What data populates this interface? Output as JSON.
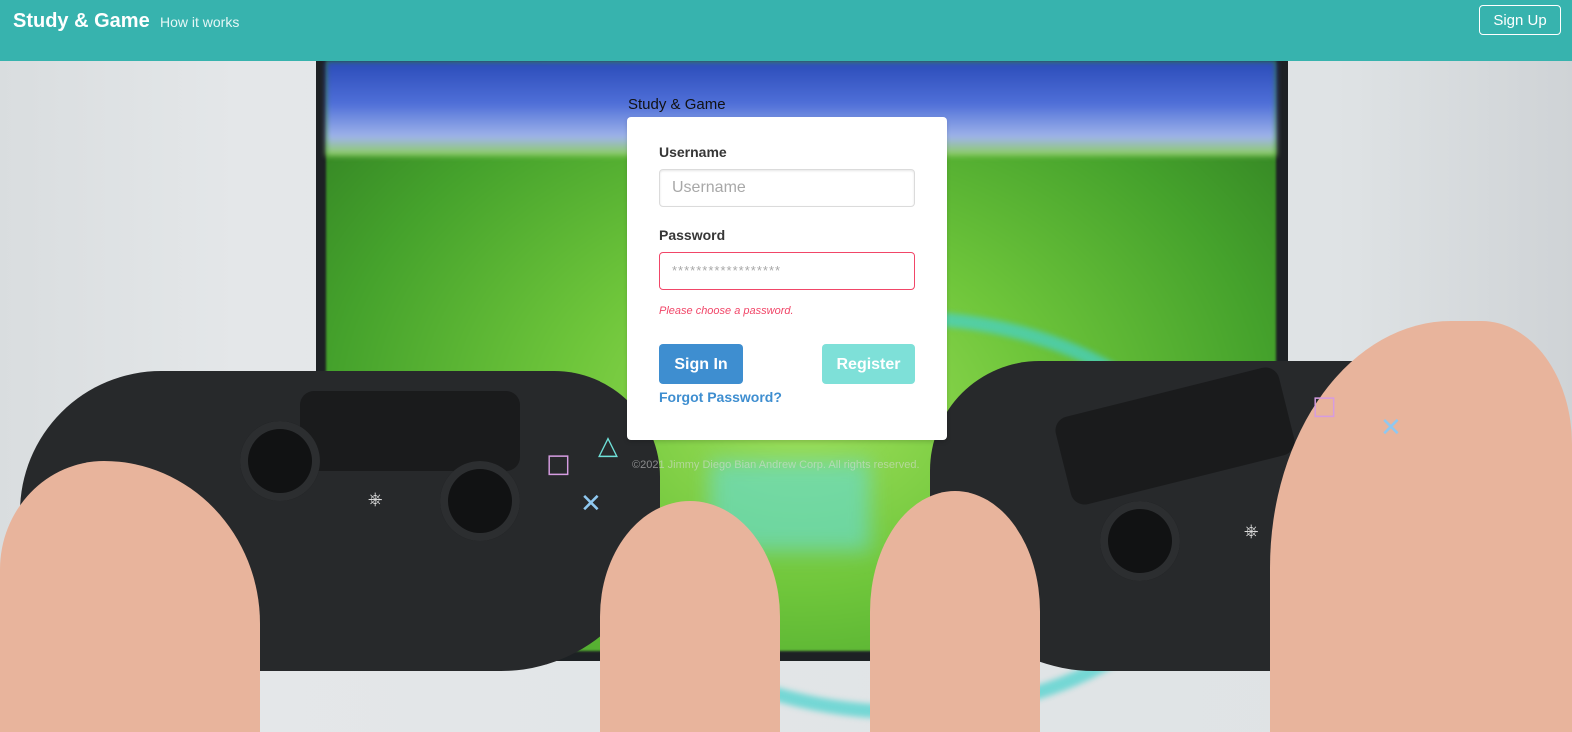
{
  "navbar": {
    "brand": "Study & Game",
    "how_it_works": "How it works",
    "sign_up": "Sign Up",
    "background_color": "#37b3ae"
  },
  "login": {
    "heading": "Study & Game",
    "username_label": "Username",
    "username_placeholder": "Username",
    "username_value": "",
    "password_label": "Password",
    "password_placeholder": "******************",
    "password_value": "",
    "password_error": "Please choose a password.",
    "sign_in": "Sign In",
    "register": "Register",
    "forgot_password": "Forgot Password?"
  },
  "footer": {
    "copyright": "©2021 Jimmy Diego Bian Andrew Corp. All rights reserved."
  },
  "colors": {
    "primary": "#3e8ed0",
    "accent": "#7ee0d8",
    "danger": "#f14668"
  },
  "background": {
    "icons": [
      "gamepad-icon",
      "playstation-logo-icon",
      "square-icon",
      "cross-icon",
      "triangle-icon"
    ]
  }
}
